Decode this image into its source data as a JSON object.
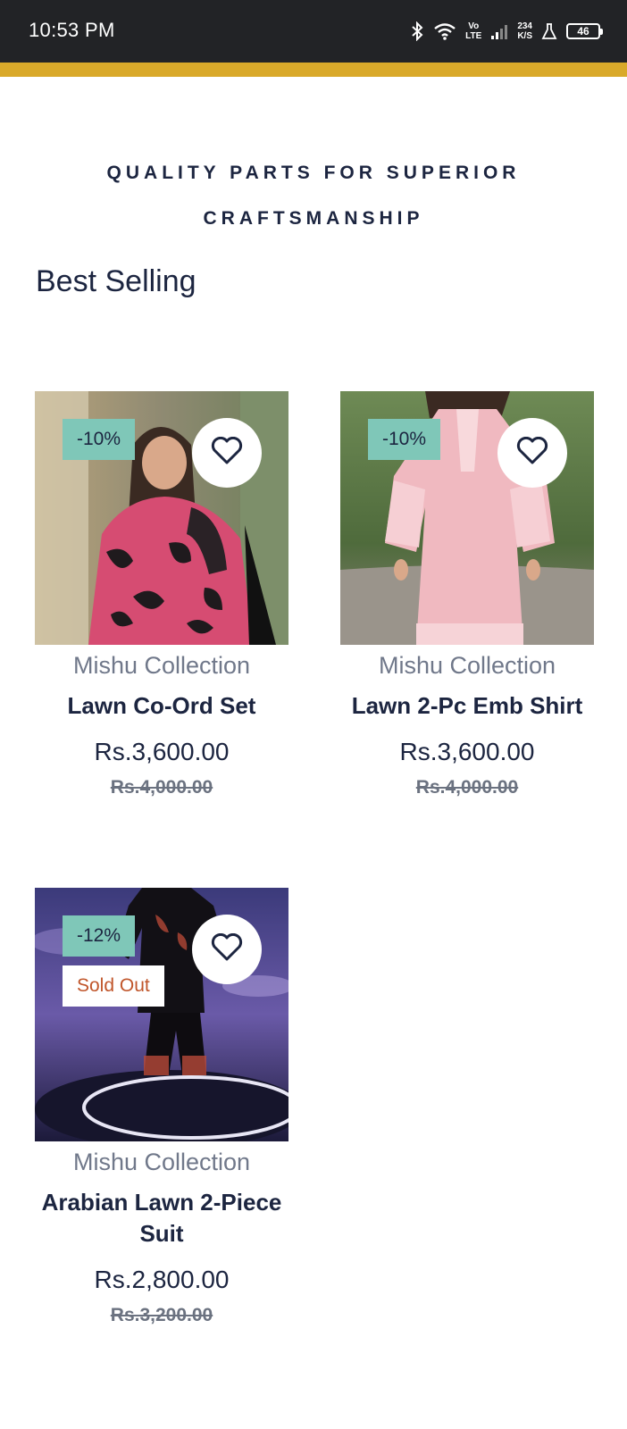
{
  "status_bar": {
    "time": "10:53 PM",
    "network_top": "Vo",
    "network_bottom": "LTE",
    "speed_top": "234",
    "speed_bottom": "K/S",
    "battery": "46",
    "icons": [
      "bluetooth-icon",
      "wifi-icon",
      "signal-icon",
      "lab-icon",
      "battery-icon"
    ]
  },
  "theme": {
    "accent": "#d9a92a",
    "navy": "#1c2540",
    "badge": "#7fc7b8",
    "sold_out_text": "#c0552a"
  },
  "banner": {
    "line1": "QUALITY PARTS FOR SUPERIOR",
    "line2": "CRAFTSMANSHIP"
  },
  "section": {
    "title": "Best Selling"
  },
  "products": [
    {
      "vendor": "Mishu Collection",
      "title": "Lawn Co-Ord Set",
      "price": "Rs.3,600.00",
      "compare_price": "Rs.4,000.00",
      "discount": "-10%",
      "sold_out": "",
      "image": "woman in pink and black floral lawn co-ord set"
    },
    {
      "vendor": "Mishu Collection",
      "title": "Lawn 2-Pc Emb Shirt",
      "price": "Rs.3,600.00",
      "compare_price": "Rs.4,000.00",
      "discount": "-10%",
      "sold_out": "",
      "image": "light pink embroidered lawn shirt"
    },
    {
      "vendor": "Mishu Collection",
      "title": "Arabian Lawn 2-Piece Suit",
      "price": "Rs.2,800.00",
      "compare_price": "Rs.3,200.00",
      "discount": "-12%",
      "sold_out": "Sold Out",
      "image": "black suit with embroidered sleeves on dark stage"
    }
  ]
}
